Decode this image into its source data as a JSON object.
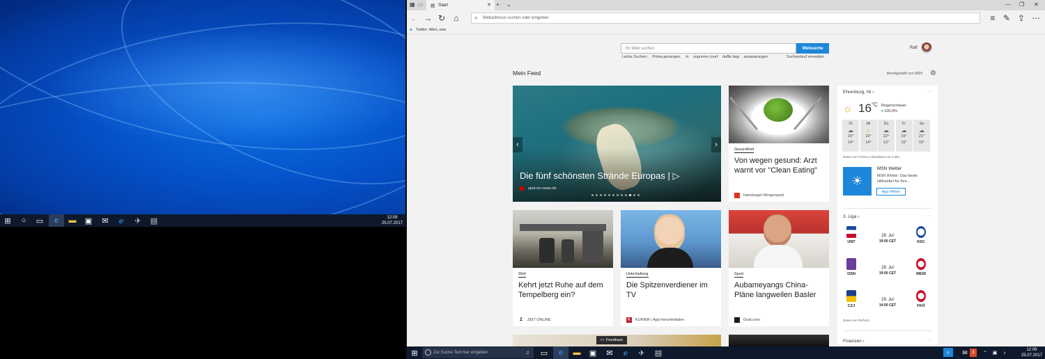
{
  "desktop": {
    "taskbar": {
      "time": "12:09",
      "date": "25.07.2017",
      "icons": [
        "windows-icon",
        "cortana-icon",
        "task-view-icon",
        "edge-icon",
        "file-explorer-icon",
        "store-icon",
        "mail-icon",
        "ie-icon",
        "network-icon",
        "notepad-icon"
      ]
    }
  },
  "browser": {
    "tab_title": "Start",
    "address_placeholder": "Webadresse suchen oder eingeben",
    "favorite": "Twitter. Alles, was",
    "accent": "#1e86d8"
  },
  "search": {
    "placeholder": "Im Web suchen",
    "button": "Websuche",
    "recent_label": "Letzte Suchen:",
    "recent": [
      "Prima gesungen.",
      "ts",
      "supreme court",
      "duffle bag",
      "aussparungen"
    ],
    "history_link": "Suchverlauf verwalten"
  },
  "user": {
    "name": "Ralf"
  },
  "feed": {
    "title": "Mein Feed",
    "provided_by": "Bereitgestellt von MSN",
    "hero": {
      "title": "Die fünf schönsten Strände Europas",
      "source": "spot-on-news.de"
    },
    "cards": [
      {
        "category": "Gesundheit",
        "headline": "Von wegen gesund: Arzt warnt vor \"Clean Eating\"",
        "source": "Hamburger Morgenpost"
      },
      {
        "category": "Welt",
        "headline": "Kehrt jetzt Ruhe auf dem Tempelberg ein?",
        "source": "ZEIT ONLINE"
      },
      {
        "category": "Unterhaltung",
        "headline": "Die Spitzenverdiener im TV",
        "source": "KURIER | App herunterladen"
      },
      {
        "category": "Sport",
        "headline": "Aubameyangs China-Pläne langweilen Basler",
        "source": "Goal.com"
      }
    ]
  },
  "weather": {
    "location": "Ehrenburg, NI",
    "temp": "16",
    "unit": "°C",
    "condition": "Regenschauer",
    "precip": "100,0%",
    "forecast": [
      {
        "day": "Di",
        "hi": "16°",
        "lo": "14°"
      },
      {
        "day": "Mi",
        "hi": "22°",
        "lo": "14°"
      },
      {
        "day": "Do",
        "hi": "22°",
        "lo": "13°"
      },
      {
        "day": "Fr",
        "hi": "19°",
        "lo": "15°"
      },
      {
        "day": "Sa",
        "hi": "21°",
        "lo": "15°"
      }
    ],
    "note": "Daten von Foreca | Aktualisiert vor 8 Min.",
    "app_title": "MSN Wetter",
    "app_desc": "MSN Wetter: Das beste Hilfsmittel für Ihre...",
    "app_button": "App öffnen"
  },
  "liga": {
    "title": "3. Liga",
    "matches": [
      {
        "home": "UNT",
        "away": "KSC",
        "date": "28. Jul",
        "time": "19:00 CET"
      },
      {
        "home": "OSN",
        "away": "WEW",
        "date": "28. Jul",
        "time": "19:00 CET"
      },
      {
        "home": "CZJ",
        "away": "FKÖ",
        "date": "29. Jul",
        "time": "14:00 CET"
      }
    ],
    "note": "Daten von Perform"
  },
  "finance": {
    "title": "Finanzen"
  },
  "feedback": "Feedback",
  "taskbar": {
    "search_placeholder": "Zur Suche Text hier eingeben",
    "time": "12:09",
    "date": "25.07.2017",
    "badge": "3"
  }
}
